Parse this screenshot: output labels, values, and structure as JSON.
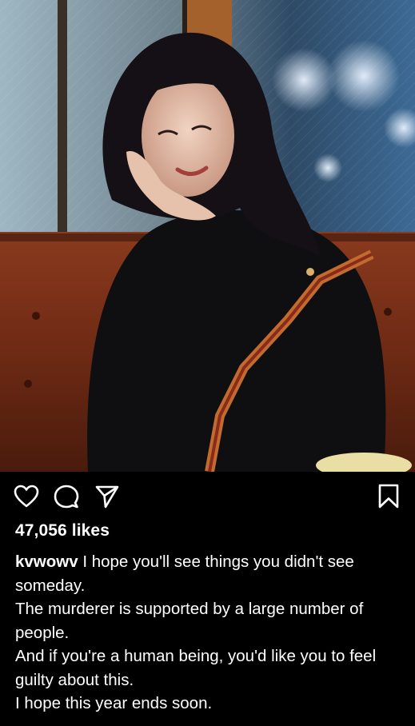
{
  "post": {
    "likes_text": "47,056 likes",
    "username": "kvwowv",
    "caption_first": "I hope you'll see things you didn't see someday.",
    "caption_lines": [
      "The murderer is supported by a large number of people.",
      "And if you're a human being, you'd like you to feel guilty about this.",
      "I hope this year ends soon."
    ]
  },
  "actions": {
    "like_icon": "heart-icon",
    "comment_icon": "comment-icon",
    "share_icon": "send-icon",
    "save_icon": "bookmark-icon"
  },
  "colors": {
    "background": "#000000",
    "text": "#ffffff"
  }
}
